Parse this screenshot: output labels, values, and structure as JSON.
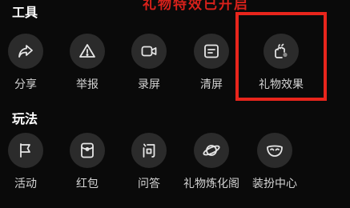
{
  "banner_partial": "礼物特效已开启",
  "sections": {
    "tools": {
      "title": "工具"
    },
    "play": {
      "title": "玩法"
    }
  },
  "tools": [
    {
      "label": "分享",
      "icon": "share-arrow-icon"
    },
    {
      "label": "举报",
      "icon": "warning-triangle-icon"
    },
    {
      "label": "录屏",
      "icon": "video-camera-icon"
    },
    {
      "label": "清屏",
      "icon": "clear-screen-icon"
    },
    {
      "label": "礼物效果",
      "icon": "gift-effect-icon"
    }
  ],
  "play": [
    {
      "label": "活动",
      "icon": "activity-flag-icon"
    },
    {
      "label": "红包",
      "icon": "red-envelope-icon"
    },
    {
      "label": "问答",
      "icon": "question-answer-icon"
    },
    {
      "label": "礼物炼化阁",
      "icon": "planet-icon"
    },
    {
      "label": "装扮中心",
      "icon": "mask-icon"
    }
  ],
  "colors": {
    "background": "#0a0a0a",
    "icon_bg": "#2b2b2b",
    "highlight": "#e8251c"
  }
}
